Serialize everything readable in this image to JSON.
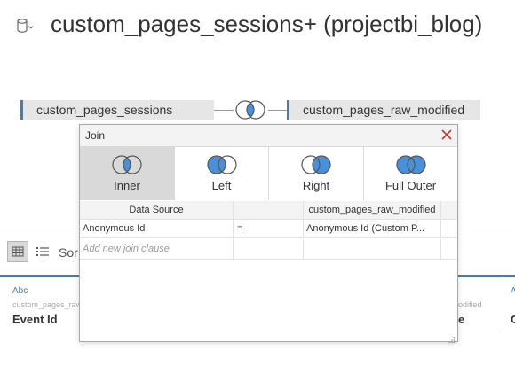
{
  "header": {
    "title": "custom_pages_sessions+ (projectbi_blog)",
    "db_icon": "database-icon"
  },
  "join_canvas": {
    "left_table": "custom_pages_sessions",
    "right_table": "custom_pages_raw_modified",
    "join_icon": "inner-join-icon"
  },
  "background_grid": {
    "sort_label": "Sor",
    "columns": [
      {
        "type": "Abc",
        "source": "custom_pages_raw",
        "name": "Event Id"
      },
      {
        "type": "",
        "source": "odified",
        "name": "e"
      },
      {
        "type": "A",
        "source": "",
        "name": "C"
      }
    ]
  },
  "dialog": {
    "title": "Join",
    "join_types": [
      {
        "label": "Inner",
        "selected": true,
        "icon": "inner-join-icon"
      },
      {
        "label": "Left",
        "selected": false,
        "icon": "left-join-icon"
      },
      {
        "label": "Right",
        "selected": false,
        "icon": "right-join-icon"
      },
      {
        "label": "Full Outer",
        "selected": false,
        "icon": "full-outer-join-icon"
      }
    ],
    "clause_headers": {
      "left": "Data Source",
      "right": "custom_pages_raw_modified"
    },
    "clauses": [
      {
        "left": "Anonymous Id",
        "op": "=",
        "right": "Anonymous Id (Custom P..."
      }
    ],
    "add_clause_placeholder": "Add new join clause"
  },
  "colors": {
    "accent": "#4e79a7",
    "join_fill": "#4a90d9",
    "selected_bg": "#d9d9d9",
    "close": "#c0392b"
  }
}
